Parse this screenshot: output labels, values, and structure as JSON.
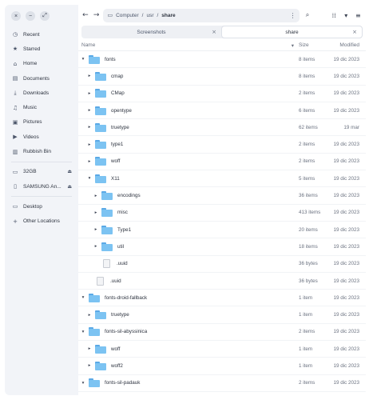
{
  "window_controls": {
    "close": "×",
    "minimize": "−",
    "maximize": "⤢"
  },
  "sidebar": {
    "items": [
      {
        "label": "Recent",
        "icon": "clock-icon",
        "glyph": "◷"
      },
      {
        "label": "Starred",
        "icon": "star-icon",
        "glyph": "★"
      },
      {
        "label": "Home",
        "icon": "home-icon",
        "glyph": "⌂"
      },
      {
        "label": "Documents",
        "icon": "documents-icon",
        "glyph": "▤"
      },
      {
        "label": "Downloads",
        "icon": "download-icon",
        "glyph": "⤓"
      },
      {
        "label": "Music",
        "icon": "music-icon",
        "glyph": "♫"
      },
      {
        "label": "Pictures",
        "icon": "pictures-icon",
        "glyph": "▣"
      },
      {
        "label": "Videos",
        "icon": "videos-icon",
        "glyph": "▶"
      },
      {
        "label": "Rubbish Bin",
        "icon": "trash-icon",
        "glyph": "▥"
      }
    ],
    "devices": [
      {
        "label": "32GB",
        "icon": "drive-icon",
        "glyph": "▭",
        "eject": "⏏"
      },
      {
        "label": "SAMSUNG An...",
        "icon": "phone-icon",
        "glyph": "▯",
        "eject": "⏏"
      }
    ],
    "other": [
      {
        "label": "Desktop",
        "icon": "desktop-icon",
        "glyph": "▭"
      },
      {
        "label": "Other Locations",
        "icon": "plus-icon",
        "glyph": "+"
      }
    ]
  },
  "toolbar": {
    "back": "←",
    "forward": "→",
    "path_home": "▭",
    "path": [
      "Computer",
      "usr",
      "share"
    ],
    "path_sep": "/",
    "kebab": "⋮",
    "search": "⌕",
    "view": "⁞⁞",
    "view_menu": "▾",
    "main_menu": "≡"
  },
  "tabs": [
    {
      "label": "Screenshots",
      "close": "×",
      "active": false
    },
    {
      "label": "share",
      "close": "×",
      "active": true
    }
  ],
  "columns": {
    "name": "Name",
    "sort": "▾",
    "size": "Size",
    "modified": "Modified"
  },
  "rows": [
    {
      "name": "fonts",
      "size": "8 items",
      "modified": "19 dic 2023",
      "level": 0,
      "expander": "▾",
      "type": "folder"
    },
    {
      "name": "cmap",
      "size": "8 items",
      "modified": "19 dic 2023",
      "level": 1,
      "expander": "▸",
      "type": "folder"
    },
    {
      "name": "CMap",
      "size": "2 items",
      "modified": "19 dic 2023",
      "level": 1,
      "expander": "▸",
      "type": "folder"
    },
    {
      "name": "opentype",
      "size": "6 items",
      "modified": "19 dic 2023",
      "level": 1,
      "expander": "▸",
      "type": "folder"
    },
    {
      "name": "truetype",
      "size": "62 items",
      "modified": "19 mar",
      "level": 1,
      "expander": "▸",
      "type": "folder"
    },
    {
      "name": "type1",
      "size": "2 items",
      "modified": "19 dic 2023",
      "level": 1,
      "expander": "▸",
      "type": "folder"
    },
    {
      "name": "woff",
      "size": "2 items",
      "modified": "19 dic 2023",
      "level": 1,
      "expander": "▸",
      "type": "folder"
    },
    {
      "name": "X11",
      "size": "5 items",
      "modified": "19 dic 2023",
      "level": 1,
      "expander": "▾",
      "type": "folder"
    },
    {
      "name": "encodings",
      "size": "36 items",
      "modified": "19 dic 2023",
      "level": 2,
      "expander": "▸",
      "type": "folder"
    },
    {
      "name": "misc",
      "size": "413 items",
      "modified": "19 dic 2023",
      "level": 2,
      "expander": "▸",
      "type": "folder"
    },
    {
      "name": "Type1",
      "size": "20 items",
      "modified": "19 dic 2023",
      "level": 2,
      "expander": "▸",
      "type": "folder"
    },
    {
      "name": "util",
      "size": "18 items",
      "modified": "19 dic 2023",
      "level": 2,
      "expander": "▸",
      "type": "folder"
    },
    {
      "name": ".uuid",
      "size": "36 bytes",
      "modified": "19 dic 2023",
      "level": 2,
      "expander": "",
      "type": "file"
    },
    {
      "name": ".uuid",
      "size": "36 bytes",
      "modified": "19 dic 2023",
      "level": 1,
      "expander": "",
      "type": "file"
    },
    {
      "name": "fonts-droid-fallback",
      "size": "1 item",
      "modified": "19 dic 2023",
      "level": 0,
      "expander": "▾",
      "type": "folder"
    },
    {
      "name": "truetype",
      "size": "1 item",
      "modified": "19 dic 2023",
      "level": 1,
      "expander": "▸",
      "type": "folder"
    },
    {
      "name": "fonts-sil-abyssinica",
      "size": "2 items",
      "modified": "19 dic 2023",
      "level": 0,
      "expander": "▾",
      "type": "folder"
    },
    {
      "name": "woff",
      "size": "1 item",
      "modified": "19 dic 2023",
      "level": 1,
      "expander": "▸",
      "type": "folder"
    },
    {
      "name": "woff2",
      "size": "1 item",
      "modified": "19 dic 2023",
      "level": 1,
      "expander": "▸",
      "type": "folder"
    },
    {
      "name": "fonts-sil-padauk",
      "size": "2 items",
      "modified": "19 dic 2023",
      "level": 0,
      "expander": "▾",
      "type": "folder"
    }
  ]
}
